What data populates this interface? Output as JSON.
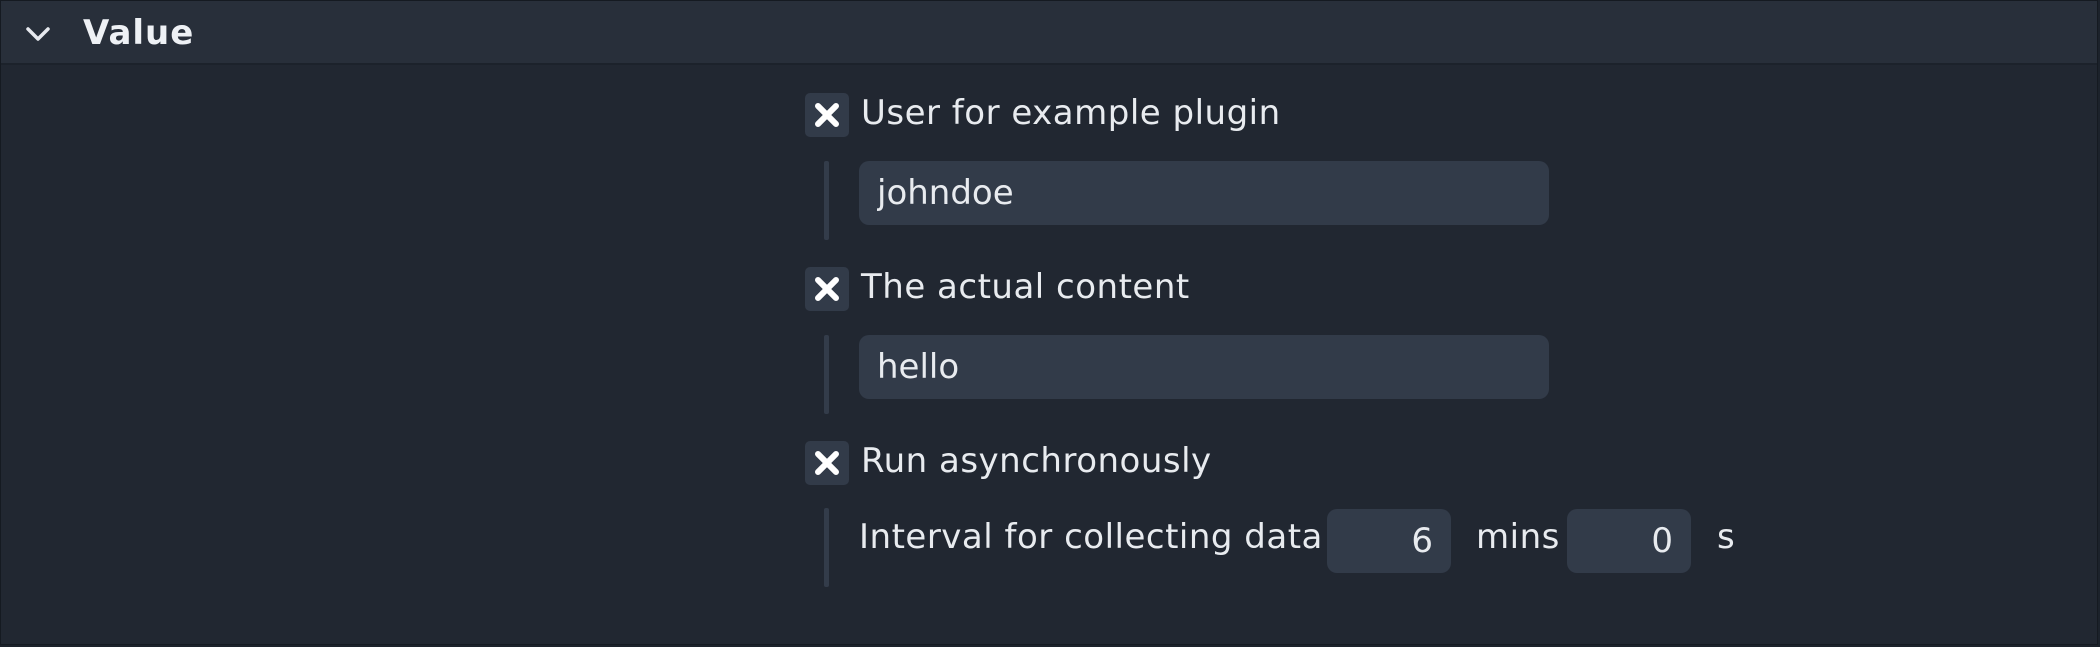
{
  "section": {
    "title": "Value",
    "collapse_icon": "chevron-down-icon"
  },
  "options": [
    {
      "label": "User for example plugin",
      "checked_icon": "close-x-icon",
      "input_value": "johndoe"
    },
    {
      "label": "The actual content",
      "checked_icon": "close-x-icon",
      "input_value": "hello"
    },
    {
      "label": "Run asynchronously",
      "checked_icon": "close-x-icon",
      "interval": {
        "label": "Interval for collecting data",
        "minutes_value": "6",
        "minutes_unit": "mins",
        "seconds_value": "0",
        "seconds_unit": "s"
      }
    }
  ],
  "colors": {
    "panel_bg": "#212731",
    "header_bg": "#282f3a",
    "input_bg": "#323b49",
    "text": "#e8ebef"
  }
}
